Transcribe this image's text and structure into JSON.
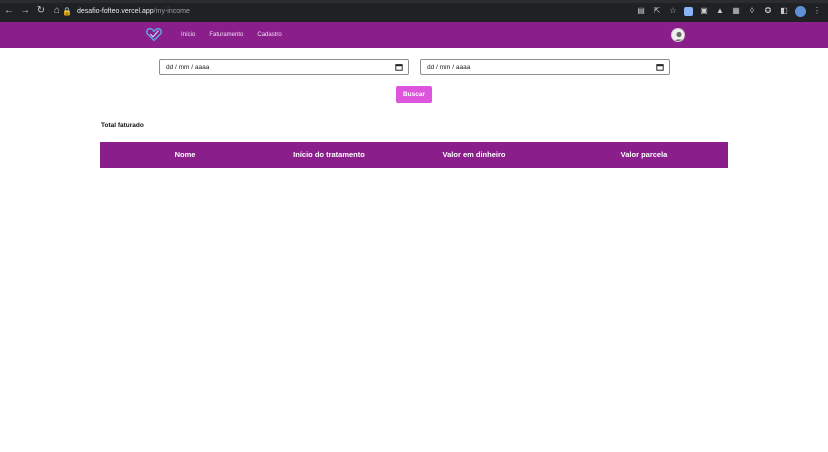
{
  "browser": {
    "url_host": "desafio-fofteo.vercel.app",
    "url_path": "/my-income"
  },
  "header": {
    "menu": [
      {
        "label": "Início"
      },
      {
        "label": "Faturamento"
      },
      {
        "label": "Cadastro"
      }
    ],
    "brand_color": "#8a1f8c"
  },
  "filters": {
    "start_date": {
      "placeholder": "dd / mm / aaaa"
    },
    "end_date": {
      "placeholder": "dd / mm / aaaa"
    },
    "search_label": "Buscar",
    "button_color": "#dc55dc"
  },
  "report": {
    "title": "Total faturado",
    "columns": [
      "Nome",
      "Início do tratamento",
      "Valor em dinheiro",
      "Valor parcela"
    ],
    "rows": []
  }
}
